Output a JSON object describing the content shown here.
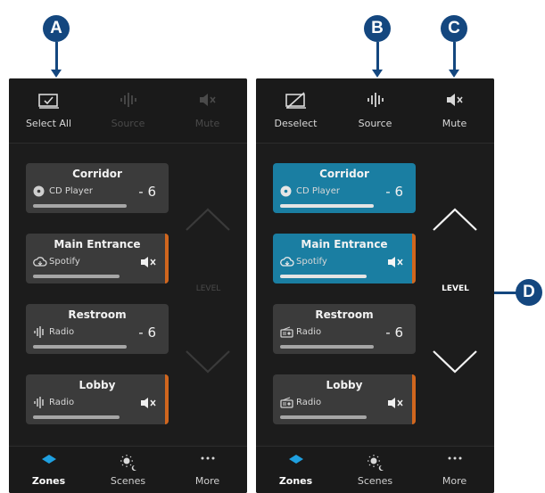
{
  "callouts": {
    "a": "A",
    "b": "B",
    "c": "C",
    "d": "D"
  },
  "left_panel": {
    "toolbar": [
      {
        "label": "Select All",
        "icon": "select-all-icon",
        "enabled": true
      },
      {
        "label": "Source",
        "icon": "source-waveform-icon",
        "enabled": false
      },
      {
        "label": "Mute",
        "icon": "mute-speaker-icon",
        "enabled": false
      }
    ],
    "zones": [
      {
        "name": "Corridor",
        "source": "CD Player",
        "source_icon": "cd-icon",
        "volume": "- 6",
        "muted": false,
        "selected": false,
        "level": 0.85
      },
      {
        "name": "Main Entrance",
        "source": "Spotify",
        "source_icon": "cloud-icon",
        "volume": "",
        "muted": true,
        "selected": false,
        "level": 0.78
      },
      {
        "name": "Restroom",
        "source": "Radio",
        "source_icon": "waveform-icon",
        "volume": "- 6",
        "muted": false,
        "selected": false,
        "level": 0.85
      },
      {
        "name": "Lobby",
        "source": "Radio",
        "source_icon": "waveform-icon",
        "volume": "",
        "muted": true,
        "selected": false,
        "level": 0.78
      }
    ],
    "level_label": "LEVEL",
    "level_enabled": false
  },
  "right_panel": {
    "toolbar": [
      {
        "label": "Deselect",
        "icon": "deselect-icon",
        "enabled": true
      },
      {
        "label": "Source",
        "icon": "source-waveform-icon",
        "enabled": true
      },
      {
        "label": "Mute",
        "icon": "mute-speaker-icon",
        "enabled": true
      }
    ],
    "zones": [
      {
        "name": "Corridor",
        "source": "CD Player",
        "source_icon": "cd-icon",
        "volume": "- 6",
        "muted": false,
        "selected": true,
        "level": 0.85
      },
      {
        "name": "Main Entrance",
        "source": "Spotify",
        "source_icon": "cloud-icon",
        "volume": "",
        "muted": true,
        "selected": true,
        "level": 0.78
      },
      {
        "name": "Restroom",
        "source": "Radio",
        "source_icon": "radio-icon",
        "volume": "- 6",
        "muted": false,
        "selected": false,
        "level": 0.85
      },
      {
        "name": "Lobby",
        "source": "Radio",
        "source_icon": "radio-icon",
        "volume": "",
        "muted": true,
        "selected": false,
        "level": 0.78
      }
    ],
    "level_label": "LEVEL",
    "level_enabled": true
  },
  "bottom_nav": [
    {
      "label": "Zones",
      "icon": "zones-diamond-icon",
      "active": true
    },
    {
      "label": "Scenes",
      "icon": "scenes-sun-moon-icon",
      "active": false
    },
    {
      "label": "More",
      "icon": "more-dots-icon",
      "active": false
    }
  ],
  "colors": {
    "selected_zone": "#1a7ea2",
    "mute_marker": "#d0661e",
    "callout": "#14477f",
    "nav_active": "#1fa0e0"
  }
}
